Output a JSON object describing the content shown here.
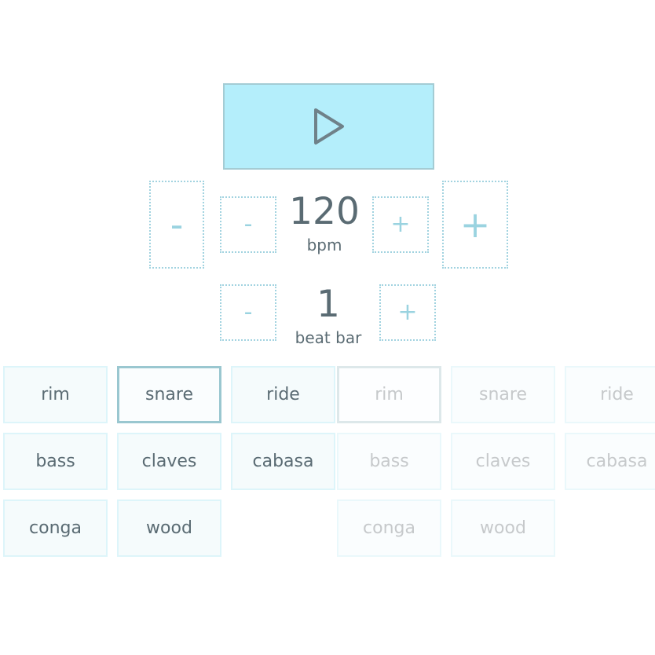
{
  "transport": {
    "play_button": {
      "icon": "play-triangle-icon",
      "label": "",
      "fill_color": "#b4eefb",
      "border_color": "#a4ccd4",
      "icon_color": "#6f8189"
    }
  },
  "tempo": {
    "decrease_large_label": "-",
    "decrease_small_label": "-",
    "value": "120",
    "unit": "bpm",
    "increase_small_label": "+",
    "increase_large_label": "+"
  },
  "bar": {
    "decrease_label": "-",
    "value": "1",
    "unit": "beat bar",
    "increase_label": "+"
  },
  "instruments": {
    "active_group": {
      "selected": "snare",
      "pads": [
        {
          "label": "rim",
          "selected": false
        },
        {
          "label": "snare",
          "selected": true
        },
        {
          "label": "ride",
          "selected": false
        },
        {
          "label": "bass",
          "selected": false
        },
        {
          "label": "claves",
          "selected": false
        },
        {
          "label": "cabasa",
          "selected": false
        },
        {
          "label": "conga",
          "selected": false
        },
        {
          "label": "wood",
          "selected": false
        }
      ]
    },
    "disabled_group": {
      "selected": "rim",
      "pads": [
        {
          "label": "rim",
          "selected": true
        },
        {
          "label": "snare",
          "selected": false
        },
        {
          "label": "ride",
          "selected": false
        },
        {
          "label": "bass",
          "selected": false
        },
        {
          "label": "claves",
          "selected": false
        },
        {
          "label": "cabasa",
          "selected": false
        },
        {
          "label": "conga",
          "selected": false
        },
        {
          "label": "wood",
          "selected": false
        }
      ]
    }
  },
  "colors": {
    "accent": "#9ad3e0",
    "play_fill": "#b4eefb",
    "text": "#5a6b73",
    "pad_border": "#ddf5fa",
    "pad_selected_border": "#9ac7d0",
    "disabled_text": "#c6c9cb"
  }
}
